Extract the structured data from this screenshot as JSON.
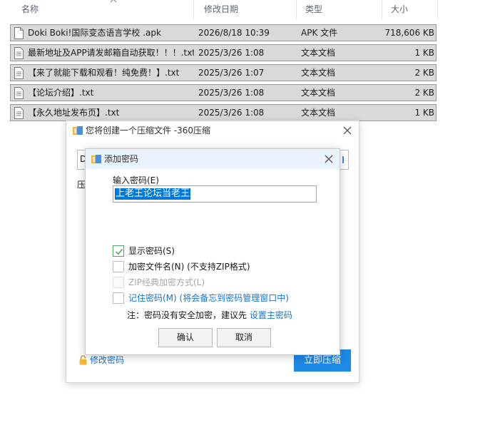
{
  "explorer": {
    "columns": {
      "name": "名称",
      "date": "修改日期",
      "type": "类型",
      "size": "大小"
    },
    "files": [
      {
        "name": "Doki Boki!国际变态语言学校  .apk",
        "date": "2026/8/18 10:39",
        "type": "APK 文件",
        "size": "718,606 KB",
        "icon": "file-icon"
      },
      {
        "name": "最新地址及APP请发邮箱自动获取！！！.txt",
        "date": "2025/3/26 1:08",
        "type": "文本文档",
        "size": "1 KB",
        "icon": "text-file-icon"
      },
      {
        "name": "【来了就能下载和观看！纯免费！】.txt",
        "date": "2025/3/26 1:07",
        "type": "文本文档",
        "size": "2 KB",
        "icon": "text-file-icon"
      },
      {
        "name": "【论坛介绍】.txt",
        "date": "2025/3/26 1:08",
        "type": "文本文档",
        "size": "2 KB",
        "icon": "text-file-icon"
      },
      {
        "name": "【永久地址发布页】.txt",
        "date": "2025/3/26 1:08",
        "type": "文本文档",
        "size": "1 KB",
        "icon": "text-file-icon"
      }
    ]
  },
  "compress_dialog": {
    "title": "您将创建一个压缩文件 -360压缩",
    "peek_field_text": "D",
    "peek_label": "压",
    "modify_password_link": "修改密码",
    "start_button": "立即压缩"
  },
  "password_dialog": {
    "title": "添加密码",
    "password_label": "输入密码(E)",
    "password_value": "上老王论坛当老王",
    "options": [
      {
        "label": "显示密码(S)",
        "checked": true,
        "disabled": false,
        "style": "normal"
      },
      {
        "label": "加密文件名(N) (不支持ZIP格式)",
        "checked": false,
        "disabled": false,
        "style": "normal"
      },
      {
        "label": "ZIP经典加密方式(L)",
        "checked": false,
        "disabled": true,
        "style": "disabled"
      },
      {
        "label": "记住密码(M) (将会备忘到密码管理窗口中)",
        "checked": false,
        "disabled": false,
        "style": "blue"
      }
    ],
    "note_text": "注：密码没有安全加密，建议先 ",
    "note_link": "设置主密码",
    "ok_button": "确认",
    "cancel_button": "取消"
  },
  "colors": {
    "accent": "#1e88e5",
    "link": "#1a73c9",
    "selection": "#0078d7",
    "check": "#52a75f"
  }
}
